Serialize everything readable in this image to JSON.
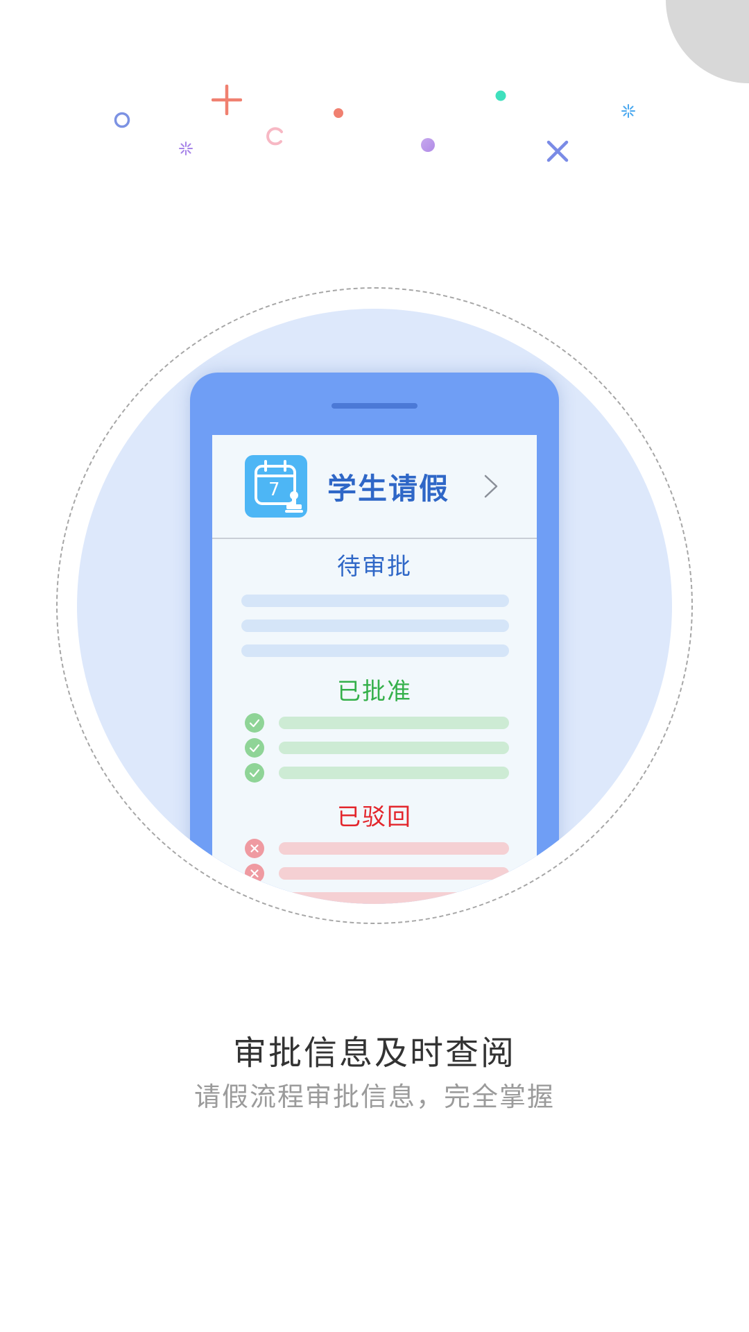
{
  "colors": {
    "accent_blue": "#2f67c7",
    "approved_green": "#34b04a",
    "rejected_red": "#e3262c",
    "close_red": "#e8483c"
  },
  "app_card": {
    "title": "学生请假",
    "icon_day": "7",
    "sections": {
      "pending": "待审批",
      "approved": "已批准",
      "rejected": "已驳回"
    }
  },
  "headline": "审批信息及时查阅",
  "subline": "请假流程审批信息，完全掌握"
}
